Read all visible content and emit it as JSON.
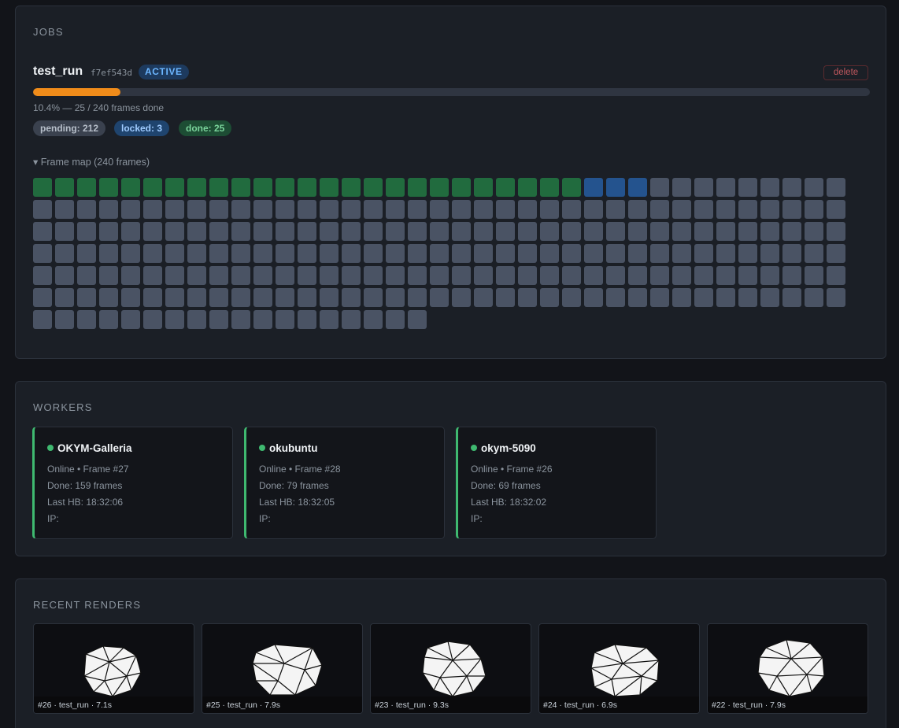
{
  "jobs": {
    "section_title": "JOBS",
    "job": {
      "name": "test_run",
      "id": "f7ef543d",
      "status": "ACTIVE",
      "delete_label": "delete",
      "progress_percent": 10.4,
      "progress_text": "10.4% — 25 / 240 frames done",
      "counts": {
        "pending": "pending: 212",
        "locked": "locked: 3",
        "done": "done: 25"
      },
      "frame_map_label": "▾ Frame map (240 frames)",
      "frames_total": 240,
      "frames_done": 25,
      "frames_locked": 3
    },
    "colors": {
      "done": "#216b3e",
      "locked": "#24538e",
      "pending": "#4a5364",
      "progress": "#f08c1a"
    }
  },
  "workers": {
    "section_title": "WORKERS",
    "items": [
      {
        "name": "OKYM-Galleria",
        "status": "Online • Frame #27",
        "done": "Done: 159 frames",
        "last_hb": "Last HB: 18:32:06",
        "ip": "IP:"
      },
      {
        "name": "okubuntu",
        "status": "Online • Frame #28",
        "done": "Done: 79 frames",
        "last_hb": "Last HB: 18:32:05",
        "ip": "IP:"
      },
      {
        "name": "okym-5090",
        "status": "Online • Frame #26",
        "done": "Done: 69 frames",
        "last_hb": "Last HB: 18:32:02",
        "ip": "IP:"
      }
    ]
  },
  "renders": {
    "section_title": "RECENT RENDERS",
    "items": [
      {
        "caption": "#26 · test_run · 7.1s"
      },
      {
        "caption": "#25 · test_run · 7.9s"
      },
      {
        "caption": "#23 · test_run · 9.3s"
      },
      {
        "caption": "#24 · test_run · 6.9s"
      },
      {
        "caption": "#22 · test_run · 7.9s"
      }
    ]
  }
}
